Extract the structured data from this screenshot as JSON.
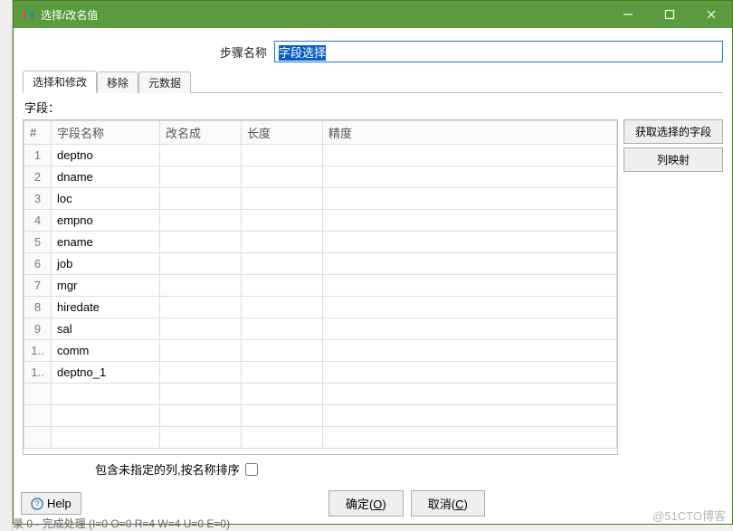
{
  "window": {
    "title": "选择/改名值"
  },
  "step": {
    "label": "步骤名称",
    "value": "字段选择"
  },
  "tabs": [
    {
      "label": "选择和修改",
      "active": true
    },
    {
      "label": "移除",
      "active": false
    },
    {
      "label": "元数据",
      "active": false
    }
  ],
  "fields_label": "字段：",
  "columns": {
    "rownum": "#",
    "fieldname": "字段名称",
    "rename": "改名成",
    "length": "长度",
    "precision": "精度"
  },
  "rows": [
    {
      "n": "1",
      "fieldname": "deptno",
      "rename": "",
      "length": "",
      "precision": ""
    },
    {
      "n": "2",
      "fieldname": "dname",
      "rename": "",
      "length": "",
      "precision": ""
    },
    {
      "n": "3",
      "fieldname": "loc",
      "rename": "",
      "length": "",
      "precision": ""
    },
    {
      "n": "4",
      "fieldname": "empno",
      "rename": "",
      "length": "",
      "precision": ""
    },
    {
      "n": "5",
      "fieldname": "ename",
      "rename": "",
      "length": "",
      "precision": ""
    },
    {
      "n": "6",
      "fieldname": "job",
      "rename": "",
      "length": "",
      "precision": ""
    },
    {
      "n": "7",
      "fieldname": "mgr",
      "rename": "",
      "length": "",
      "precision": ""
    },
    {
      "n": "8",
      "fieldname": "hiredate",
      "rename": "",
      "length": "",
      "precision": ""
    },
    {
      "n": "9",
      "fieldname": "sal",
      "rename": "",
      "length": "",
      "precision": ""
    },
    {
      "n": "1..",
      "fieldname": "comm",
      "rename": "",
      "length": "",
      "precision": ""
    },
    {
      "n": "1..",
      "fieldname": "deptno_1",
      "rename": "",
      "length": "",
      "precision": ""
    }
  ],
  "side_buttons": {
    "get_fields": "获取选择的字段",
    "column_map": "列映射"
  },
  "include_unspecified_label": "包含未指定的列,按名称排序",
  "buttons": {
    "help": "Help",
    "ok": "确定(",
    "ok_key": "O",
    "ok_tail": ")",
    "cancel": "取消(",
    "cancel_key": "C",
    "cancel_tail": ")"
  },
  "watermark": "@51CTO博客",
  "status": "录 0 - 完成处理 (I=0  O=0  R=4  W=4  U=0  E=0)"
}
